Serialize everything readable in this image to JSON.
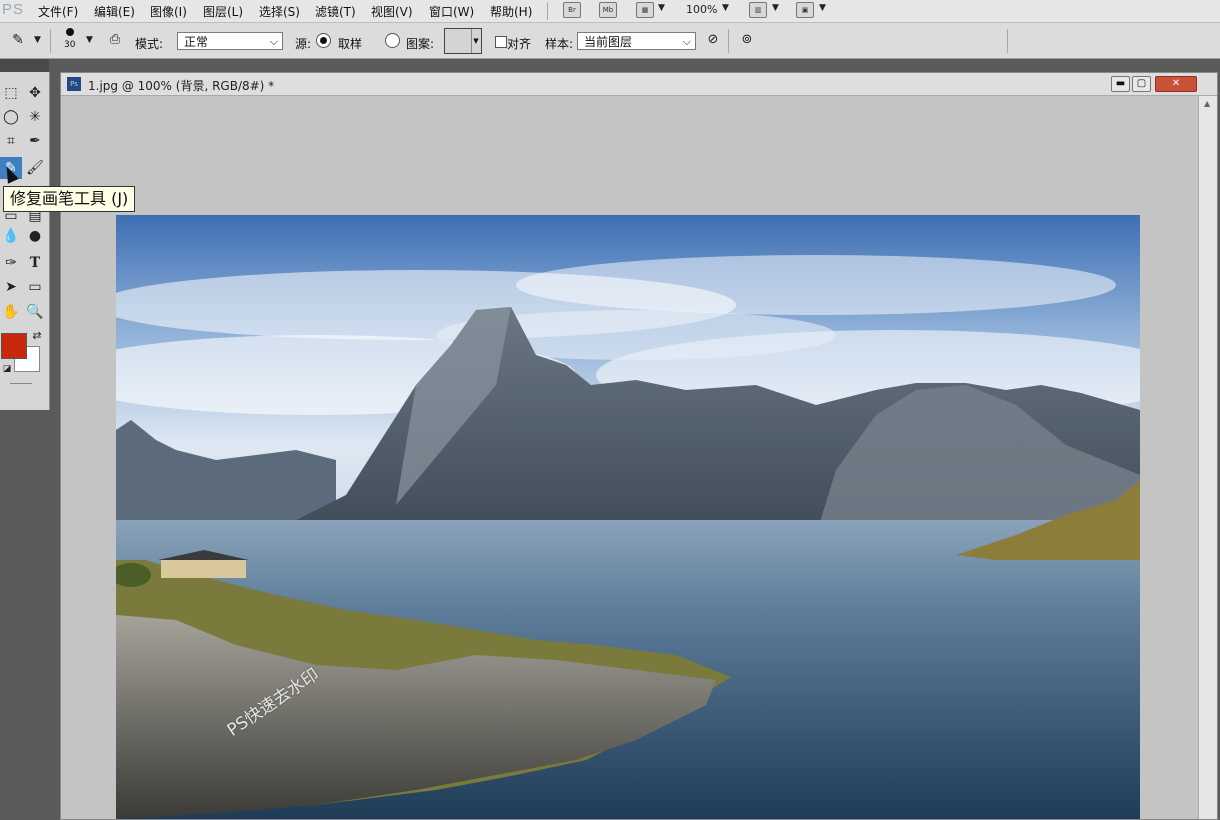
{
  "app": {
    "logo": "PS"
  },
  "menu": [
    "文件(F)",
    "编辑(E)",
    "图像(I)",
    "图层(L)",
    "选择(S)",
    "滤镜(T)",
    "视图(V)",
    "窗口(W)",
    "帮助(H)"
  ],
  "menubar_buttons": {
    "bridge": "Br",
    "mini_bridge": "Mb",
    "zoom": "100%"
  },
  "options": {
    "brush_size": "30",
    "mode_label": "模式:",
    "mode_value": "正常",
    "source_label": "源:",
    "sampled_label": "取样",
    "pattern_label": "图案:",
    "aligned_label": "对齐",
    "sample_label": "样本:",
    "sample_value": "当前图层"
  },
  "tooltip": "修复画笔工具 (J)",
  "document": {
    "title": "1.jpg @ 100% (背景, RGB/8#) *",
    "watermark": "PS快速去水印"
  },
  "colors": {
    "foreground": "#c8290e",
    "background": "#ffffff",
    "accent": "#3d7fc1"
  }
}
